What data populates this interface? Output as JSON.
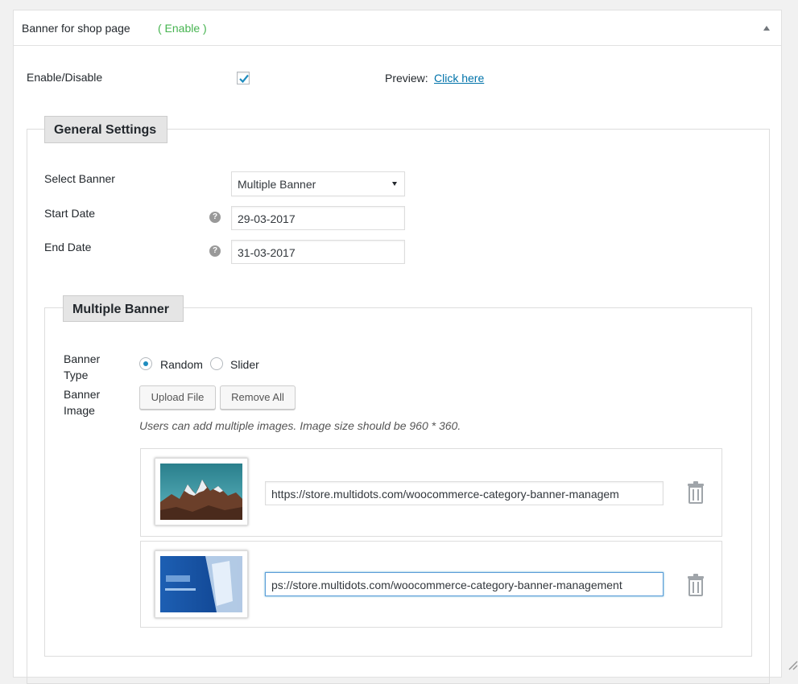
{
  "panel": {
    "title": "Banner for shop page",
    "status": "( Enable )"
  },
  "top_row": {
    "enable_label": "Enable/Disable",
    "enable_checked": true,
    "preview_label": "Preview:",
    "preview_link": "Click here"
  },
  "general_settings": {
    "legend": "General Settings",
    "select_banner_label": "Select Banner",
    "select_banner_value": "Multiple Banner",
    "start_date_label": "Start Date",
    "start_date_value": "29-03-2017",
    "end_date_label": "End Date",
    "end_date_value": "31-03-2017",
    "help_icon": "?"
  },
  "multiple_banner": {
    "legend": "Multiple Banner",
    "banner_type_label_1": "Banner",
    "banner_type_label_2": "Type",
    "radio_random": "Random",
    "radio_slider": "Slider",
    "selected_type": "Random",
    "banner_image_label_1": "Banner",
    "banner_image_label_2": "Image",
    "upload_button": "Upload File",
    "remove_all_button": "Remove All",
    "note": "Users can add multiple images. Image size should be 960 * 360.",
    "images": [
      {
        "url": "https://store.multidots.com/woocommerce-category-banner-managem",
        "thumb": "mountain-image"
      },
      {
        "url": "ps://store.multidots.com/woocommerce-category-banner-management",
        "thumb": "blue-banner-image"
      }
    ]
  },
  "colors": {
    "status_green": "#46b450",
    "link_blue": "#0073aa",
    "radio_blue": "#1e8cbe",
    "focus_border": "#5b9dd9"
  }
}
